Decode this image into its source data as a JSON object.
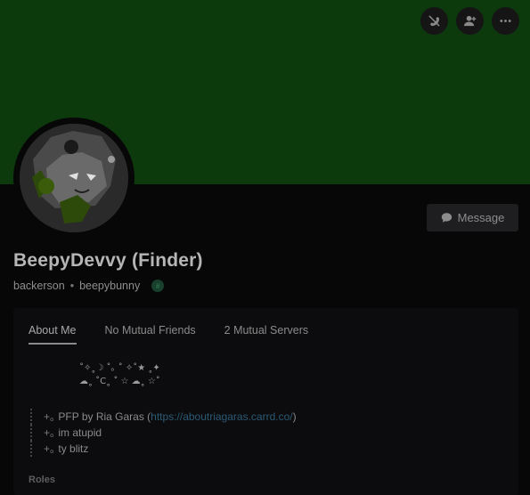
{
  "top_actions": {
    "icons": [
      "no-call-icon",
      "add-friend-icon",
      "more-icon"
    ]
  },
  "message_button": {
    "label": "Message"
  },
  "user": {
    "display_name": "BeepyDevvy (Finder)",
    "username": "backerson",
    "pronouns": "beepybunny"
  },
  "tabs": [
    {
      "label": "About Me",
      "active": true
    },
    {
      "label": "No Mutual Friends",
      "active": false
    },
    {
      "label": "2 Mutual Servers",
      "active": false
    }
  ],
  "about": {
    "decoration_line1": "˚✧˳☽ ˚｡ ˚ ✧˚★ ˳✦",
    "decoration_line2": "☁˳ ˚C˳ ˚ ☆ ☁˳ ☆˚",
    "bio": [
      {
        "prefix": "+｡",
        "text": "PFP by Ria Garas (",
        "link": "https://aboutriagaras.carrd.co/",
        "suffix": ")"
      },
      {
        "prefix": "+｡",
        "text": "im atupid"
      },
      {
        "prefix": "+｡",
        "text": "ty blitz"
      }
    ],
    "roles_heading": "Roles"
  },
  "colors": {
    "banner": "#0d3a0d",
    "background": "#070708",
    "link": "#2b5a74"
  }
}
